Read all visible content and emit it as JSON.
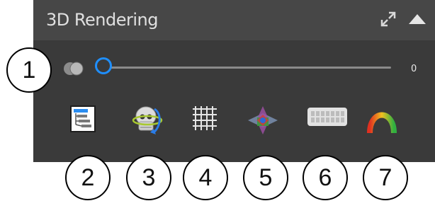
{
  "panel": {
    "title": "3D Rendering",
    "header_icons": [
      "expand-icon",
      "collapse-arrow-icon"
    ]
  },
  "slider": {
    "icon": "opacity-spheres-icon",
    "value": "0",
    "position_fraction": 0
  },
  "tools": [
    {
      "name": "scene-tree-icon"
    },
    {
      "name": "skull-rotate-icon"
    },
    {
      "name": "grid-icon"
    },
    {
      "name": "color-volume-icon"
    },
    {
      "name": "dental-arch-icon"
    },
    {
      "name": "gradient-arc-icon"
    }
  ],
  "callouts": [
    "1",
    "2",
    "3",
    "4",
    "5",
    "6",
    "7"
  ],
  "colors": {
    "panel_bg": "#3a3a3a",
    "header_bg": "#474747",
    "accent_blue": "#1f8fff"
  }
}
